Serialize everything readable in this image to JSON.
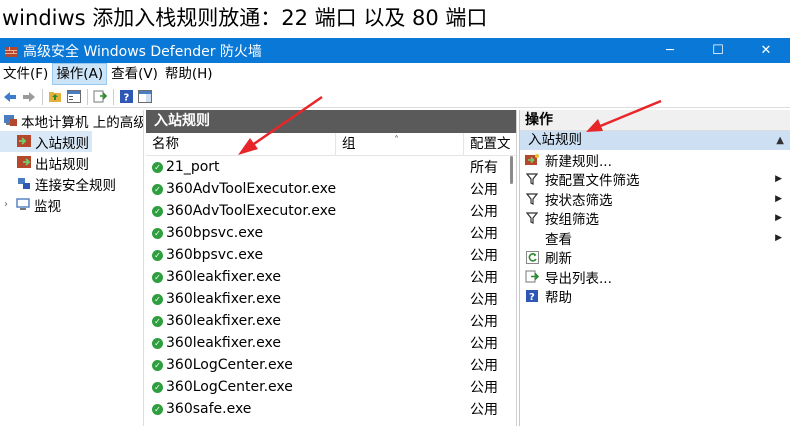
{
  "caption": "windiws 添加入栈规则放通：22 端口 以及 80 端口",
  "window": {
    "title": "高级安全 Windows Defender 防火墙",
    "minimize": "─",
    "maximize": "☐",
    "close": "✕"
  },
  "menu": [
    {
      "label": "文件(F)"
    },
    {
      "label": "操作(A)"
    },
    {
      "label": "查看(V)"
    },
    {
      "label": "帮助(H)"
    }
  ],
  "tree": {
    "root": "本地计算机 上的高级",
    "items": [
      "入站规则",
      "出站规则",
      "连接安全规则",
      "监视"
    ]
  },
  "center": {
    "title": "入站规则",
    "columns": [
      "名称",
      "组",
      "配置文"
    ],
    "rows": [
      {
        "name": "21_port",
        "profile": "所有"
      },
      {
        "name": "360AdvToolExecutor.exe",
        "profile": "公用"
      },
      {
        "name": "360AdvToolExecutor.exe",
        "profile": "公用"
      },
      {
        "name": "360bpsvc.exe",
        "profile": "公用"
      },
      {
        "name": "360bpsvc.exe",
        "profile": "公用"
      },
      {
        "name": "360leakfixer.exe",
        "profile": "公用"
      },
      {
        "name": "360leakfixer.exe",
        "profile": "公用"
      },
      {
        "name": "360leakfixer.exe",
        "profile": "公用"
      },
      {
        "name": "360leakfixer.exe",
        "profile": "公用"
      },
      {
        "name": "360LogCenter.exe",
        "profile": "公用"
      },
      {
        "name": "360LogCenter.exe",
        "profile": "公用"
      },
      {
        "name": "360safe.exe",
        "profile": "公用"
      }
    ]
  },
  "actions": {
    "title": "操作",
    "section": "入站规则",
    "items": [
      {
        "label": "新建规则...",
        "icon": "new-rule-icon"
      },
      {
        "label": "按配置文件筛选",
        "icon": "filter-icon"
      },
      {
        "label": "按状态筛选",
        "icon": "filter-icon"
      },
      {
        "label": "按组筛选",
        "icon": "filter-icon"
      },
      {
        "label": "查看",
        "icon": "none"
      },
      {
        "label": "刷新",
        "icon": "refresh-icon"
      },
      {
        "label": "导出列表...",
        "icon": "export-icon"
      },
      {
        "label": "帮助",
        "icon": "help-icon"
      }
    ]
  },
  "colors": {
    "titlebar": "#0a78d7",
    "panel_header": "#5a5a5a",
    "selection": "#cde0f3",
    "annotation_arrow": "#e8262a",
    "rule_enabled": "#2e9e3e"
  }
}
